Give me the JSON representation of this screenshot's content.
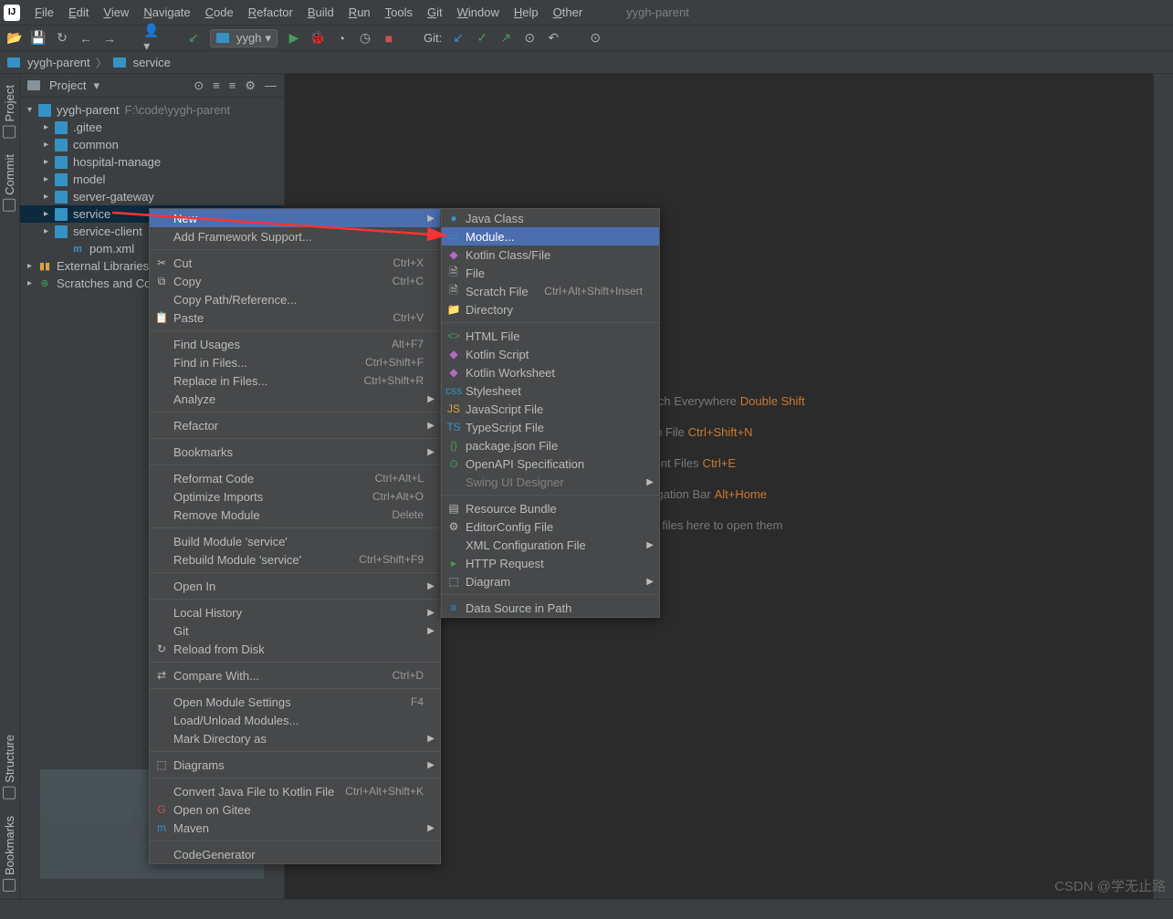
{
  "app": {
    "title": "yygh-parent"
  },
  "menus": [
    "File",
    "Edit",
    "View",
    "Navigate",
    "Code",
    "Refactor",
    "Build",
    "Run",
    "Tools",
    "Git",
    "Window",
    "Help",
    "Other"
  ],
  "runConfig": "yygh",
  "gitLabel": "Git:",
  "breadcrumb": {
    "a": "yygh-parent",
    "b": "service"
  },
  "leftTabs": [
    "Project",
    "Commit",
    "Structure",
    "Bookmarks"
  ],
  "sidebar": {
    "title": "Project",
    "tree": {
      "root": {
        "name": "yygh-parent",
        "path": "F:\\code\\yygh-parent"
      },
      "folders": [
        ".gitee",
        "common",
        "hospital-manage",
        "model",
        "server-gateway",
        "service",
        "service-client"
      ],
      "pom": "pom.xml",
      "extLib": "External Libraries",
      "scratch": "Scratches and Consoles"
    }
  },
  "contextMenu1": [
    {
      "label": "New",
      "sub": true,
      "hl": true
    },
    {
      "label": "Add Framework Support..."
    },
    {
      "sep": true
    },
    {
      "label": "Cut",
      "short": "Ctrl+X",
      "icon": "✂"
    },
    {
      "label": "Copy",
      "short": "Ctrl+C",
      "icon": "⧉"
    },
    {
      "label": "Copy Path/Reference..."
    },
    {
      "label": "Paste",
      "short": "Ctrl+V",
      "icon": "📋"
    },
    {
      "sep": true
    },
    {
      "label": "Find Usages",
      "short": "Alt+F7"
    },
    {
      "label": "Find in Files...",
      "short": "Ctrl+Shift+F"
    },
    {
      "label": "Replace in Files...",
      "short": "Ctrl+Shift+R"
    },
    {
      "label": "Analyze",
      "sub": true
    },
    {
      "sep": true
    },
    {
      "label": "Refactor",
      "sub": true
    },
    {
      "sep": true
    },
    {
      "label": "Bookmarks",
      "sub": true
    },
    {
      "sep": true
    },
    {
      "label": "Reformat Code",
      "short": "Ctrl+Alt+L"
    },
    {
      "label": "Optimize Imports",
      "short": "Ctrl+Alt+O"
    },
    {
      "label": "Remove Module",
      "short": "Delete"
    },
    {
      "sep": true
    },
    {
      "label": "Build Module 'service'"
    },
    {
      "label": "Rebuild Module 'service'",
      "short": "Ctrl+Shift+F9"
    },
    {
      "sep": true
    },
    {
      "label": "Open In",
      "sub": true
    },
    {
      "sep": true
    },
    {
      "label": "Local History",
      "sub": true
    },
    {
      "label": "Git",
      "sub": true
    },
    {
      "label": "Reload from Disk",
      "icon": "↻"
    },
    {
      "sep": true
    },
    {
      "label": "Compare With...",
      "short": "Ctrl+D",
      "icon": "⇄"
    },
    {
      "sep": true
    },
    {
      "label": "Open Module Settings",
      "short": "F4"
    },
    {
      "label": "Load/Unload Modules..."
    },
    {
      "label": "Mark Directory as",
      "sub": true
    },
    {
      "sep": true
    },
    {
      "label": "Diagrams",
      "sub": true,
      "icon": "⬚"
    },
    {
      "sep": true
    },
    {
      "label": "Convert Java File to Kotlin File",
      "short": "Ctrl+Alt+Shift+K"
    },
    {
      "label": "Open on Gitee",
      "icon": "G",
      "iconColor": "#c75450"
    },
    {
      "label": "Maven",
      "sub": true,
      "icon": "m",
      "iconColor": "#3592c4"
    },
    {
      "sep": true
    },
    {
      "label": "CodeGenerator"
    }
  ],
  "contextMenu2": [
    {
      "label": "Java Class",
      "icon": "●",
      "iconColor": "#3592c4"
    },
    {
      "label": "Module...",
      "hl": true,
      "icon": "▭",
      "iconColor": "#3592c4"
    },
    {
      "label": "Kotlin Class/File",
      "icon": "◆",
      "iconColor": "#b769c6"
    },
    {
      "label": "File",
      "icon": "🗎"
    },
    {
      "label": "Scratch File",
      "short": "Ctrl+Alt+Shift+Insert",
      "icon": "🗎"
    },
    {
      "label": "Directory",
      "icon": "📁"
    },
    {
      "sep": true
    },
    {
      "label": "HTML File",
      "icon": "<>",
      "iconColor": "#499c54"
    },
    {
      "label": "Kotlin Script",
      "icon": "◆",
      "iconColor": "#b769c6"
    },
    {
      "label": "Kotlin Worksheet",
      "icon": "◆",
      "iconColor": "#b769c6"
    },
    {
      "label": "Stylesheet",
      "icon": "css",
      "iconColor": "#3592c4"
    },
    {
      "label": "JavaScript File",
      "icon": "JS",
      "iconColor": "#d9a343"
    },
    {
      "label": "TypeScript File",
      "icon": "TS",
      "iconColor": "#3592c4"
    },
    {
      "label": "package.json File",
      "icon": "{}",
      "iconColor": "#499c54"
    },
    {
      "label": "OpenAPI Specification",
      "icon": "⊙",
      "iconColor": "#499c54"
    },
    {
      "label": "Swing UI Designer",
      "sub": true,
      "disabled": true
    },
    {
      "sep": true
    },
    {
      "label": "Resource Bundle",
      "icon": "▤"
    },
    {
      "label": "EditorConfig File",
      "icon": "⚙"
    },
    {
      "label": "XML Configuration File",
      "sub": true,
      "icon": "</>",
      "iconColor": "#d9a343"
    },
    {
      "label": "HTTP Request",
      "icon": "▸",
      "iconColor": "#499c54"
    },
    {
      "label": "Diagram",
      "sub": true,
      "icon": "⬚"
    },
    {
      "sep": true
    },
    {
      "label": "Data Source in Path",
      "icon": "≡",
      "iconColor": "#3592c4"
    }
  ],
  "hints": [
    {
      "text": "Search Everywhere",
      "short": "Double Shift"
    },
    {
      "text": "Go to File",
      "short": "Ctrl+Shift+N"
    },
    {
      "text": "Recent Files",
      "short": "Ctrl+E"
    },
    {
      "text": "Navigation Bar",
      "short": "Alt+Home"
    },
    {
      "text": "Drop files here to open them",
      "short": ""
    }
  ],
  "watermark": "CSDN @学无止路"
}
